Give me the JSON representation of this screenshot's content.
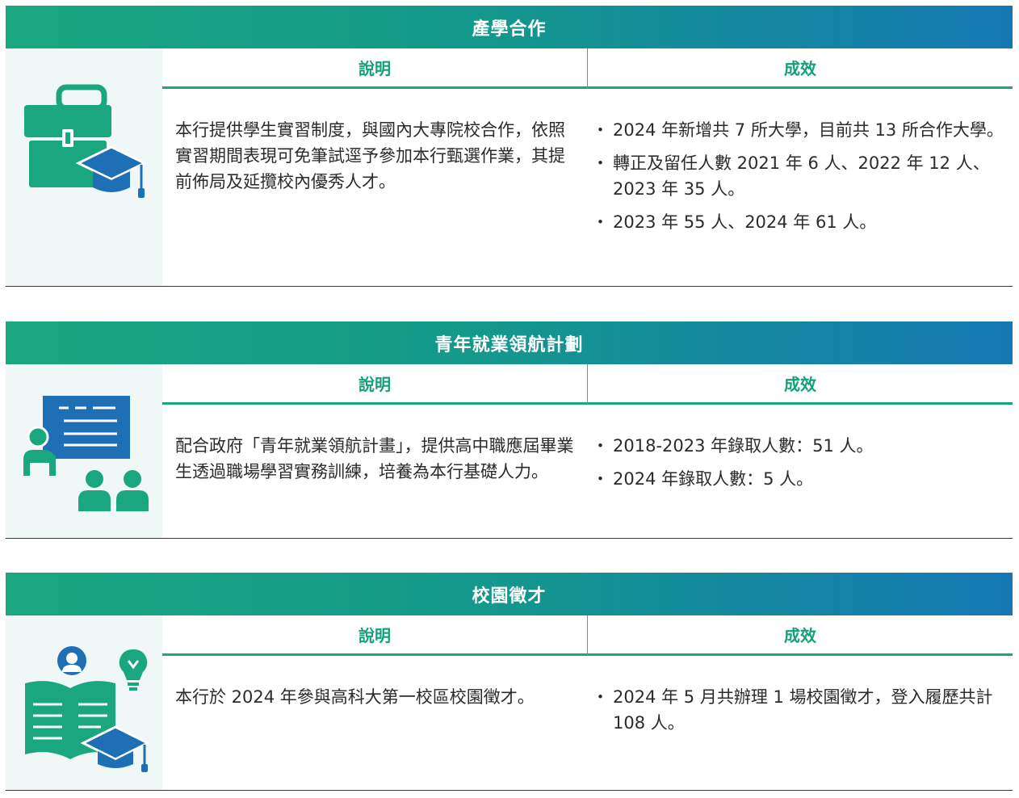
{
  "sections": [
    {
      "title": "產學合作",
      "col_desc": "說明",
      "col_result": "成效",
      "description": "本行提供學生實習制度，與國內大專院校合作，依照實習期間表現可免筆試逕予參加本行甄選作業，其提前佈局及延攬校內優秀人才。",
      "results": [
        "2024 年新增共 7 所大學，目前共 13 所合作大學。",
        "轉正及留任人數 2021 年 6 人、2022 年 12 人、2023 年 35 人。",
        "2023 年 55 人、2024 年 61 人。"
      ],
      "icon": "briefcase-graduation-cap-icon"
    },
    {
      "title": "青年就業領航計劃",
      "col_desc": "說明",
      "col_result": "成效",
      "description": "配合政府「青年就業領航計畫」，提供高中職應屆畢業生透過職場學習實務訓練，培養為本行基礎人力。",
      "results": [
        "2018-2023 年錄取人數：51 人。",
        "2024 年錄取人數：5 人。"
      ],
      "icon": "classroom-presentation-icon"
    },
    {
      "title": "校園徵才",
      "col_desc": "說明",
      "col_result": "成效",
      "description": "本行於 2024 年參與高科大第一校區校園徵才。",
      "results": [
        "2024 年 5 月共辦理 1 場校園徵才，登入履歷共計 108 人。"
      ],
      "icon": "book-person-idea-icon"
    }
  ],
  "colors": {
    "green": "#1aa77f",
    "blue": "#1578b4",
    "icon_bg": "#eff8f7"
  }
}
